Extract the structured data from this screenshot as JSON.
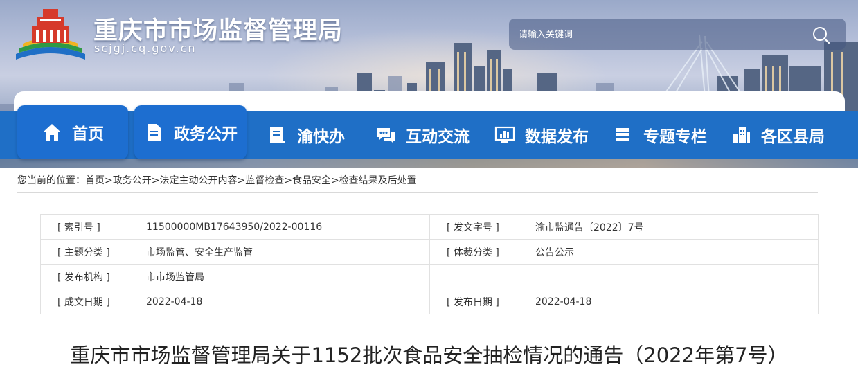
{
  "site": {
    "title": "重庆市市场监督管理局",
    "domain": "scjgj.cq.gov.cn"
  },
  "search": {
    "placeholder": "请输入关键词",
    "icon": "search-icon"
  },
  "nav": {
    "items": [
      {
        "label": "首页",
        "icon": "home-icon",
        "active": true
      },
      {
        "label": "政务公开",
        "icon": "document-icon",
        "active": true
      },
      {
        "label": "渝快办",
        "icon": "book-icon",
        "active": false
      },
      {
        "label": "互动交流",
        "icon": "chat-icon",
        "active": false
      },
      {
        "label": "数据发布",
        "icon": "chart-monitor-icon",
        "active": false
      },
      {
        "label": "专题专栏",
        "icon": "layers-icon",
        "active": false
      },
      {
        "label": "各区县局",
        "icon": "buildings-icon",
        "active": false
      }
    ]
  },
  "breadcrumb": {
    "prefix": "您当前的位置：",
    "items": [
      "首页",
      "政务公开",
      "法定主动公开内容",
      "监督检查",
      "食品安全",
      "检查结果及后处置"
    ],
    "separator": ">"
  },
  "info": {
    "rows": [
      {
        "label1": "[ 索引号 ]",
        "value1": "11500000MB17643950/2022-00116",
        "label2": "[ 发文字号 ]",
        "value2": "渝市监通告〔2022〕7号"
      },
      {
        "label1": "[ 主题分类 ]",
        "value1": "市场监管、安全生产监管",
        "label2": "[ 体裁分类 ]",
        "value2": "公告公示"
      },
      {
        "label1": "[ 发布机构 ]",
        "value1": "市市场监管局",
        "label2": "",
        "value2": ""
      },
      {
        "label1": "[ 成文日期 ]",
        "value1": "2022-04-18",
        "label2": "[ 发布日期 ]",
        "value2": "2022-04-18"
      }
    ]
  },
  "article": {
    "title": "重庆市市场监督管理局关于1152批次食品安全抽检情况的通告（2022年第7号）"
  },
  "colors": {
    "nav_blue": "#1f6fc6",
    "active_tab": "#1d6ed0",
    "text": "#333333"
  }
}
